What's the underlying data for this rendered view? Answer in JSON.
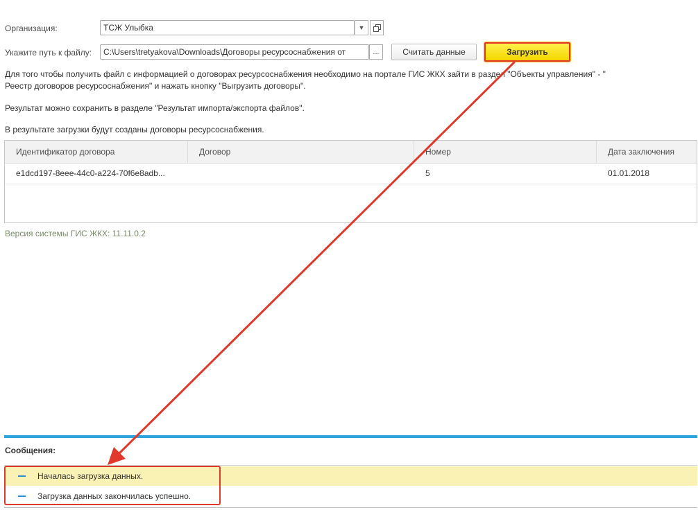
{
  "form": {
    "org_label": "Организация:",
    "org_value": "ТСЖ Улыбка",
    "path_label": "Укажите путь к файлу:",
    "path_value": "C:\\Users\\tretyakova\\Downloads\\Договоры ресурсоснабжения от",
    "browse_label": "...",
    "read_button": "Считать данные",
    "load_button": "Загрузить"
  },
  "info": {
    "line1": "Для того чтобы получить файл с информацией о договорах ресурсоснабжения необходимо на портале ГИС ЖКХ зайти в раздел \"Объекты управления\" - \"",
    "line2": "Реестр договоров ресурсоснабжения\" и нажать кнопку \"Выгрузить договоры\".",
    "line3": "Результат можно сохранить в разделе \"Результат импорта/экспорта файлов\".",
    "line4": "В результате загрузки будут созданы договоры ресурсоснабжения."
  },
  "table": {
    "columns": [
      "Идентификатор договора",
      "Договор",
      "Номер",
      "Дата заключения"
    ],
    "rows": [
      [
        "e1dcd197-8eee-44c0-a224-70f6e8adb...",
        "",
        "5",
        "01.01.2018"
      ]
    ]
  },
  "version": "Версия системы ГИС ЖКХ: 11.11.0.2",
  "messages": {
    "title": "Сообщения:",
    "items": [
      "Началась загрузка данных.",
      "Загрузка данных закончилась успешно."
    ]
  },
  "colors": {
    "accent": "#2ea3dc",
    "primary_button": "#f3d600",
    "annotation": "#e0392b",
    "active_message": "#faf1b5"
  },
  "icons": {
    "dropdown": "chevron-down-icon",
    "open": "open-form-icon",
    "message_bullet": "dash-icon"
  }
}
